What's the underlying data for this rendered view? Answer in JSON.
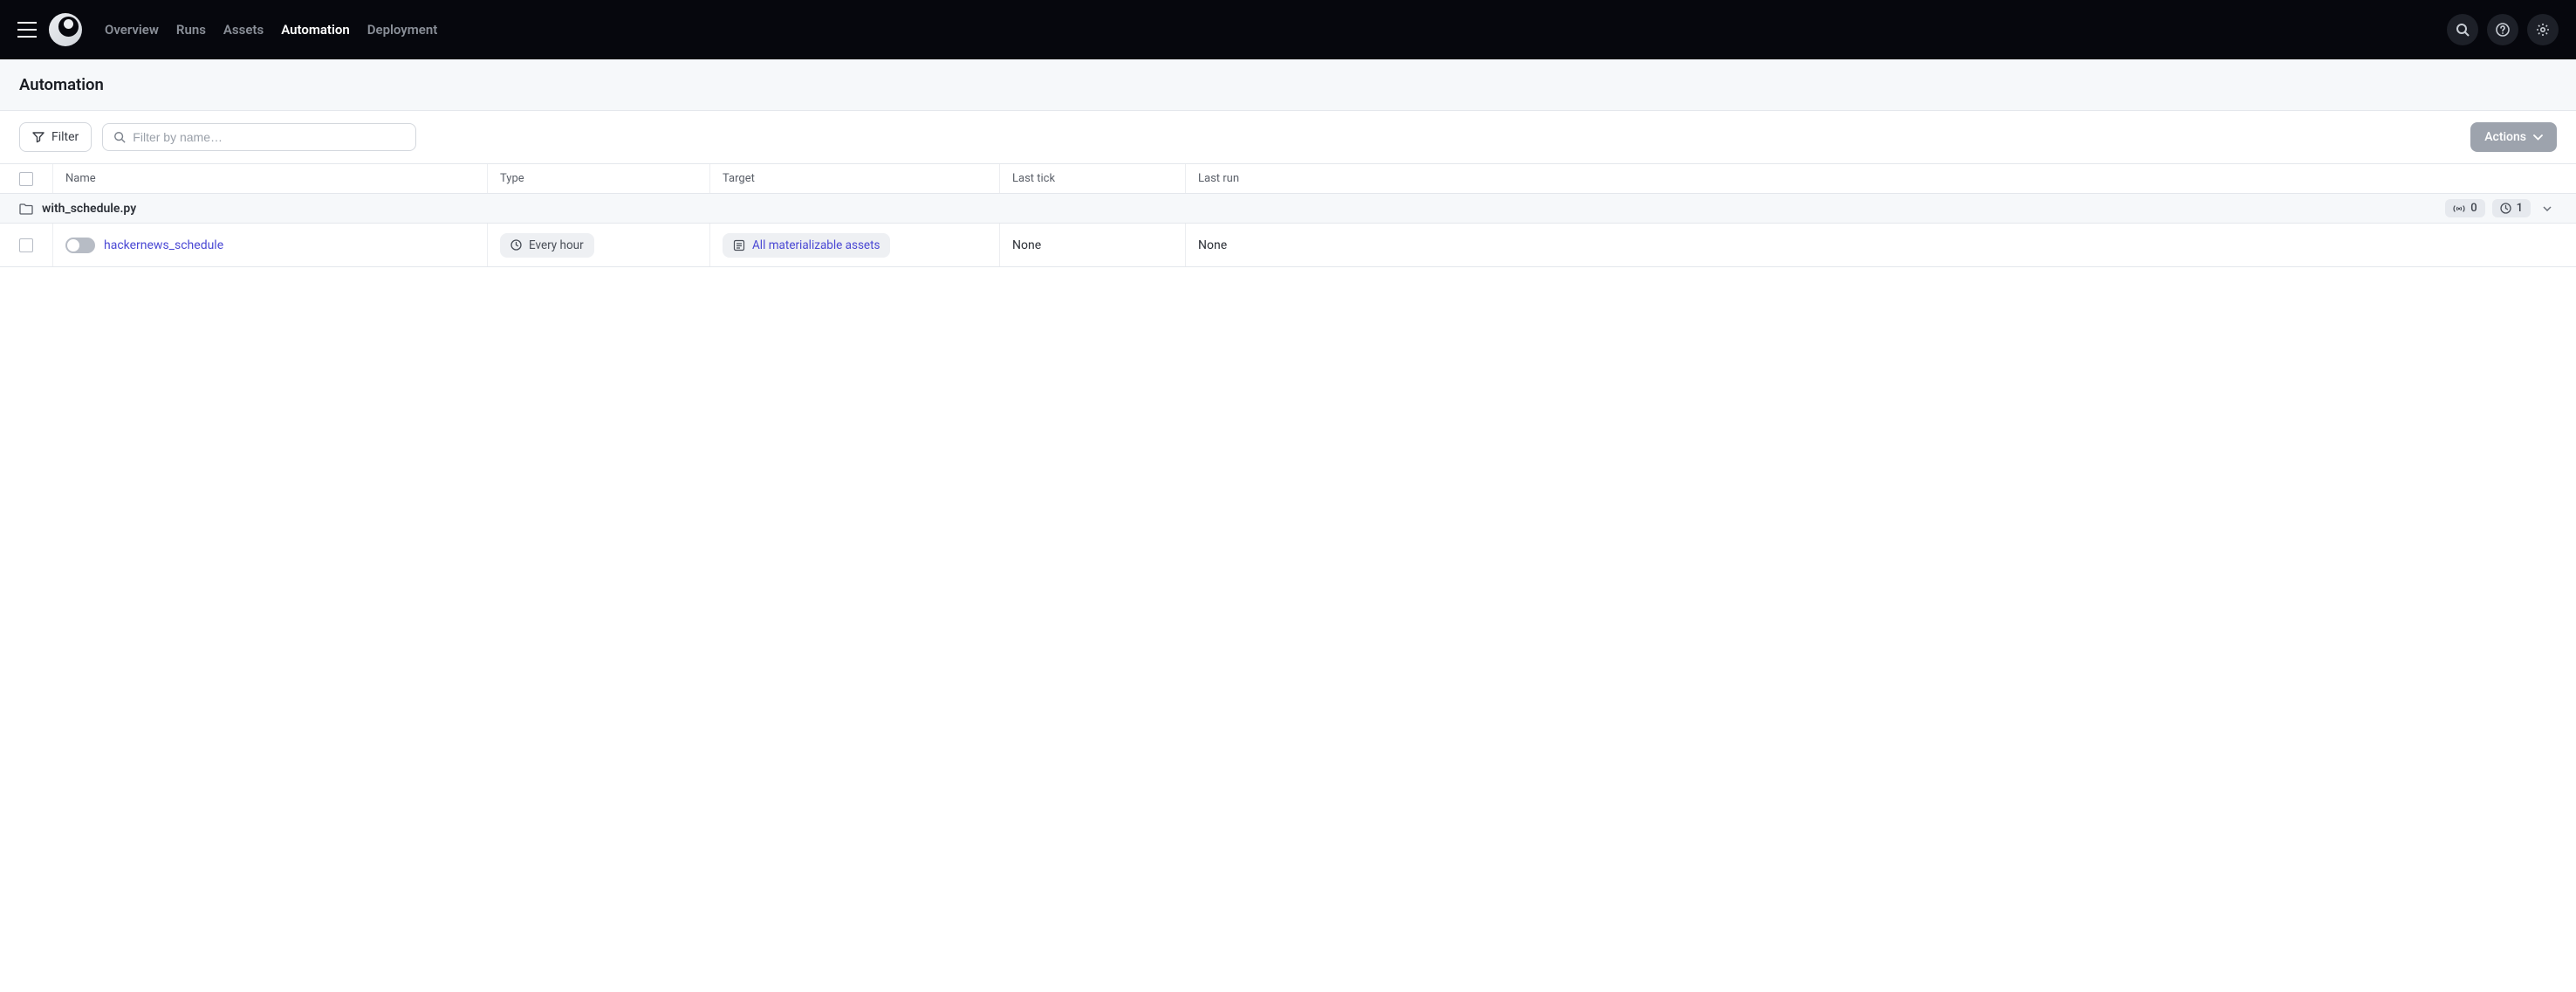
{
  "nav": {
    "links": [
      "Overview",
      "Runs",
      "Assets",
      "Automation",
      "Deployment"
    ],
    "active_index": 3
  },
  "page": {
    "title": "Automation"
  },
  "toolbar": {
    "filter_label": "Filter",
    "search_placeholder": "Filter by name…",
    "actions_label": "Actions"
  },
  "table": {
    "columns": [
      "Name",
      "Type",
      "Target",
      "Last tick",
      "Last run"
    ],
    "groups": [
      {
        "file": "with_schedule.py",
        "sensor_count": 0,
        "schedule_count": 1,
        "rows": [
          {
            "name": "hackernews_schedule",
            "enabled": false,
            "type": "Every hour",
            "target": "All materializable assets",
            "last_tick": "None",
            "last_run": "None"
          }
        ]
      }
    ]
  }
}
